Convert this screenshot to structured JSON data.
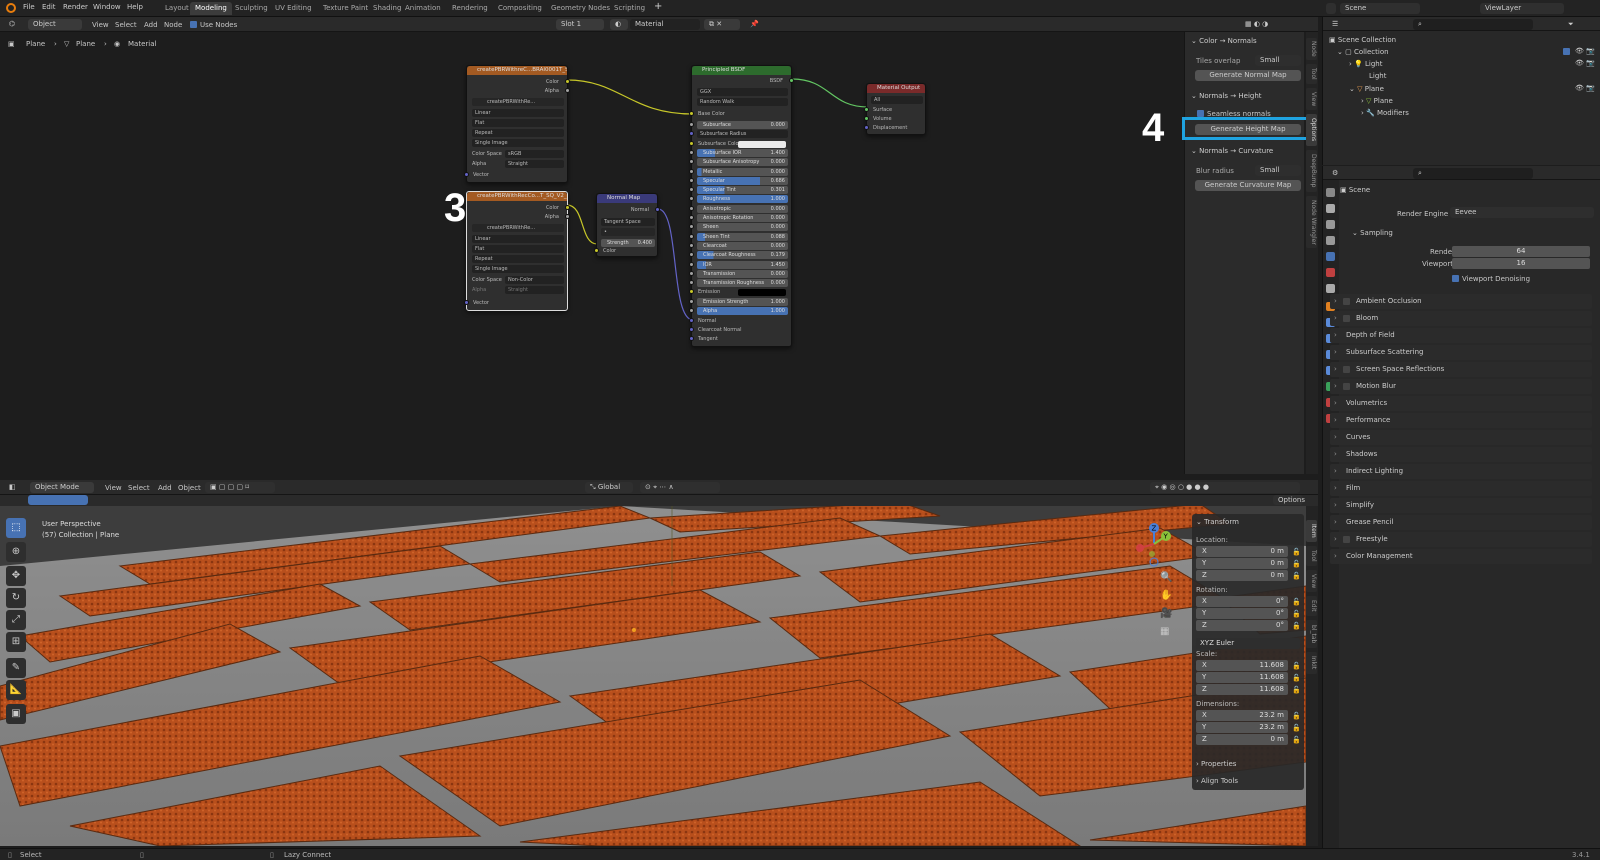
{
  "menu": {
    "file": "File",
    "edit": "Edit",
    "render": "Render",
    "window": "Window",
    "help": "Help"
  },
  "workspaces": [
    "Layout",
    "Modeling",
    "Sculpting",
    "UV Editing",
    "Texture Paint",
    "Shading",
    "Animation",
    "Rendering",
    "Compositing",
    "Geometry Nodes",
    "Scripting"
  ],
  "active_workspace": "Modeling",
  "scene_field": "Scene",
  "viewlayer_field": "ViewLayer",
  "node_header": {
    "mode": "Object",
    "view": "View",
    "select": "Select",
    "add": "Add",
    "node": "Node",
    "use_nodes": "Use Nodes",
    "slot": "Slot 1",
    "material": "Material"
  },
  "breadcrumb": {
    "a": "Plane",
    "b": "Plane",
    "c": "Material"
  },
  "image_node_1": {
    "title": "createPBRWithreC...BRAI0001T_SQ_V2.jpg",
    "out_color": "Color",
    "out_alpha": "Alpha",
    "image_name": "createPBRWithRe...",
    "interp": "Linear",
    "proj": "Flat",
    "ext": "Repeat",
    "source": "Single Image",
    "cs_label": "Color Space",
    "cs_value": "sRGB",
    "alpha_label": "Alpha",
    "alpha_value": "Straight",
    "in_vector": "Vector"
  },
  "image_node_2": {
    "title": "createPBRWithRecCo...T_SQ_V2_normals.jpg",
    "out_color": "Color",
    "out_alpha": "Alpha",
    "image_name": "createPBRWithRe...",
    "interp": "Linear",
    "proj": "Flat",
    "ext": "Repeat",
    "source": "Single Image",
    "cs_label": "Color Space",
    "cs_value": "Non-Color",
    "alpha_label": "Alpha",
    "alpha_value": "Straight",
    "in_vector": "Vector"
  },
  "normal_map_node": {
    "title": "Normal Map",
    "out_normal": "Normal",
    "space": "Tangent Space",
    "strength_label": "Strength",
    "strength_value": "0.400",
    "in_color": "Color"
  },
  "bsdf_node": {
    "title": "Principled BSDF",
    "out": "BSDF",
    "dist": "GGX",
    "sss_method": "Random Walk",
    "base_color": "Base Color",
    "rows": [
      {
        "label": "Subsurface",
        "value": "0.000",
        "fill": 0
      },
      {
        "label": "Subsurface Radius",
        "value": "",
        "fill": -1
      },
      {
        "label": "Subsurface Color",
        "value": "",
        "fill": -2
      },
      {
        "label": "Subsurface IOR",
        "value": "1.400",
        "fill": 0.2
      },
      {
        "label": "Subsurface Anisotropy",
        "value": "0.000",
        "fill": 0
      },
      {
        "label": "Metallic",
        "value": "0.000",
        "fill": 0.05
      },
      {
        "label": "Specular",
        "value": "0.686",
        "fill": 0.69
      },
      {
        "label": "Specular Tint",
        "value": "0.301",
        "fill": 0.3
      },
      {
        "label": "Roughness",
        "value": "1.000",
        "fill": 1
      },
      {
        "label": "Anisotropic",
        "value": "0.000",
        "fill": 0
      },
      {
        "label": "Anisotropic Rotation",
        "value": "0.000",
        "fill": 0
      },
      {
        "label": "Sheen",
        "value": "0.000",
        "fill": 0
      },
      {
        "label": "Sheen Tint",
        "value": "0.088",
        "fill": 0.09
      },
      {
        "label": "Clearcoat",
        "value": "0.000",
        "fill": 0
      },
      {
        "label": "Clearcoat Roughness",
        "value": "0.179",
        "fill": 0.18
      },
      {
        "label": "IOR",
        "value": "1.450",
        "fill": 0.1
      },
      {
        "label": "Transmission",
        "value": "0.000",
        "fill": 0
      },
      {
        "label": "Transmission Roughness",
        "value": "0.000",
        "fill": 0
      },
      {
        "label": "Emission",
        "value": "",
        "fill": -3
      },
      {
        "label": "Emission Strength",
        "value": "1.000",
        "fill": 0
      },
      {
        "label": "Alpha",
        "value": "1.000",
        "fill": 1
      }
    ],
    "normal": "Normal",
    "clearcoat_normal": "Clearcoat Normal",
    "tangent": "Tangent"
  },
  "output_node": {
    "title": "Material Output",
    "target": "All",
    "surface": "Surface",
    "volume": "Volume",
    "displacement": "Displacement"
  },
  "annotations": {
    "step3": "3",
    "step4": "4"
  },
  "deepbump": {
    "sec1": "Color → Normals",
    "tiles_label": "Tiles overlap",
    "tiles_value": "Small",
    "gen_normal": "Generate Normal Map",
    "sec2": "Normals → Height",
    "seamless": "Seamless normals",
    "gen_height": "Generate Height Map",
    "sec3": "Normals → Curvature",
    "blur_label": "Blur radius",
    "blur_value": "Small",
    "gen_curv": "Generate Curvature Map"
  },
  "node_side_tabs": [
    "Node",
    "Tool",
    "View",
    "Options",
    "DeepBump",
    "Node Wrangler"
  ],
  "viewport_header": {
    "mode": "Object Mode",
    "view": "View",
    "select": "Select",
    "add": "Add",
    "object": "Object",
    "orient": "Global",
    "options": "Options"
  },
  "viewport_overlay": {
    "persp": "User Perspective",
    "collection": "(57) Collection | Plane"
  },
  "transform": {
    "title": "Transform",
    "location": "Location:",
    "rotation": "Rotation:",
    "scale": "Scale:",
    "dimensions": "Dimensions:",
    "loc": [
      {
        "axis": "X",
        "value": "0 m"
      },
      {
        "axis": "Y",
        "value": "0 m"
      },
      {
        "axis": "Z",
        "value": "0 m"
      }
    ],
    "rot": [
      {
        "axis": "X",
        "value": "0°"
      },
      {
        "axis": "Y",
        "value": "0°"
      },
      {
        "axis": "Z",
        "value": "0°"
      }
    ],
    "rot_mode": "XYZ Euler",
    "scl": [
      {
        "axis": "X",
        "value": "11.608"
      },
      {
        "axis": "Y",
        "value": "11.608"
      },
      {
        "axis": "Z",
        "value": "11.608"
      }
    ],
    "dim": [
      {
        "axis": "X",
        "value": "23.2 m"
      },
      {
        "axis": "Y",
        "value": "23.2 m"
      },
      {
        "axis": "Z",
        "value": "0 m"
      }
    ],
    "properties": "Properties",
    "align_tools": "Align Tools"
  },
  "vp_side_tabs": [
    "Item",
    "Tool",
    "View",
    "Edit",
    "bl_tab",
    "InkIt"
  ],
  "outliner": {
    "scene_collection": "Scene Collection",
    "collection": "Collection",
    "light": "Light",
    "light_data": "Light",
    "plane": "Plane",
    "plane_mesh": "Plane",
    "modifiers": "Modifiers"
  },
  "properties": {
    "scene": "Scene",
    "engine_label": "Render Engine",
    "engine_value": "Eevee",
    "sampling": "Sampling",
    "render_label": "Render",
    "render_value": "64",
    "viewport_label": "Viewport",
    "viewport_value": "16",
    "denoise": "Viewport Denoising",
    "sections": [
      "Ambient Occlusion",
      "Bloom",
      "Depth of Field",
      "Subsurface Scattering",
      "Screen Space Reflections",
      "Motion Blur",
      "Volumetrics",
      "Performance",
      "Curves",
      "Shadows",
      "Indirect Lighting",
      "Film",
      "Simplify",
      "Grease Pencil",
      "Freestyle",
      "Color Management"
    ],
    "checkable": [
      true,
      true,
      false,
      false,
      true,
      true,
      false,
      false,
      false,
      false,
      false,
      false,
      false,
      false,
      true,
      false
    ]
  },
  "statusbar": {
    "select": "Select",
    "lazy": "Lazy Connect",
    "version": "3.4.1"
  },
  "colors": {
    "accent": "#4772b3",
    "highlight_box": "#1fa3e0",
    "image_header": "#a35a22",
    "bsdf_header": "#2d6b2d",
    "output_header": "#7a2a2a",
    "vector_header": "#3a3a7a"
  }
}
